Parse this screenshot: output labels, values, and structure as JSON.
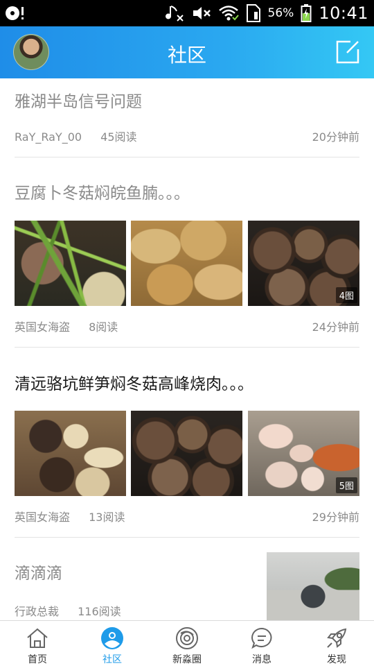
{
  "statusbar": {
    "battery": "56%",
    "clock": "10:41"
  },
  "header": {
    "title": "社区"
  },
  "posts": [
    {
      "title": "雅湖半岛信号问题",
      "author": "RaY_RaY_00",
      "reads": "45阅读",
      "time": "20分钟前"
    },
    {
      "title": "豆腐卜冬菇焖皖鱼腩。。。",
      "images": [
        "scallion-fish",
        "fried-tofu",
        "shiitake"
      ],
      "image_count": "4图",
      "author": "英国女海盗",
      "reads": "8阅读",
      "time": "24分钟前"
    },
    {
      "title": "清远骆坑鲜笋焖冬菇高峰烧肉。。。",
      "images": [
        "bamboo-shoot-mushroom",
        "shiitake",
        "roast-pork"
      ],
      "image_count": "5图",
      "author": "英国女海盗",
      "reads": "13阅读",
      "time": "29分钟前"
    },
    {
      "title": "滴滴滴",
      "images": [
        "street-car"
      ],
      "author": "行政总裁",
      "reads": "116阅读"
    }
  ],
  "nav": {
    "items": [
      {
        "label": "首页",
        "icon": "home-icon"
      },
      {
        "label": "社区",
        "icon": "community-icon",
        "active": true
      },
      {
        "label": "新淼圈",
        "icon": "circle-icon"
      },
      {
        "label": "消息",
        "icon": "message-icon"
      },
      {
        "label": "发现",
        "icon": "rocket-icon"
      }
    ]
  },
  "colors": {
    "header_start": "#1f8de8",
    "header_end": "#34c8f4",
    "active_tab": "#1e9be9"
  }
}
